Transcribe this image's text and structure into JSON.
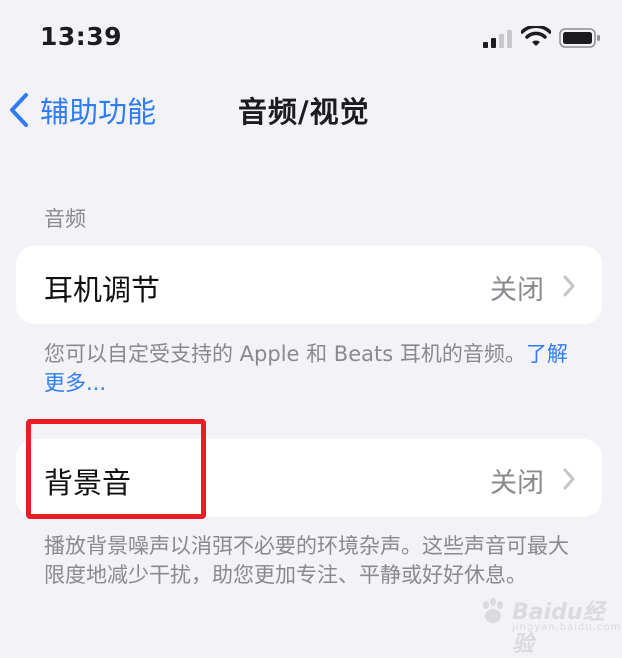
{
  "status_bar": {
    "time": "13:39"
  },
  "nav": {
    "back_label": "辅助功能",
    "title": "音频/视觉"
  },
  "section": {
    "header": "音频"
  },
  "cells": [
    {
      "label": "耳机调节",
      "value": "关闭"
    },
    {
      "label": "背景音",
      "value": "关闭"
    }
  ],
  "footers": {
    "headphones": {
      "text": "您可以自定受支持的 Apple 和 Beats 耳机的音频。",
      "link": "了解更多..."
    },
    "background": {
      "text": "播放背景噪声以消弭不必要的环境杂声。这些声音可最大限度地减少干扰，助您更加专注、平静或好好休息。"
    }
  },
  "annotation": {
    "color": "#ec1c24"
  },
  "watermark": {
    "text": "Baidu经验",
    "subtext": "jingyan.baidu.com"
  },
  "colors": {
    "accent": "#2f7cf6",
    "secondary": "#8a8a8e",
    "background": "#f2f2f7"
  }
}
